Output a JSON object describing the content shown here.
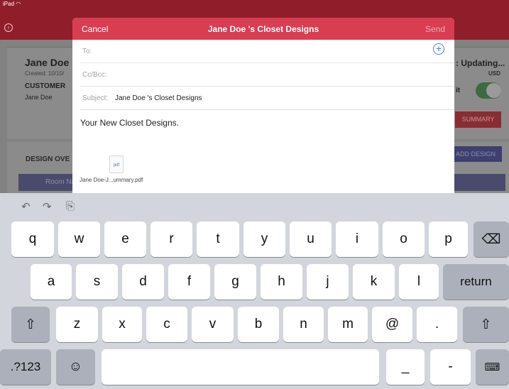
{
  "status_bar": {
    "device": "iPad"
  },
  "app": {
    "customer": {
      "name": "Jane Doe",
      "created": "Created: 10/10/",
      "type_label": "CUSTOMER",
      "contact": "Jane Doe"
    },
    "auto_updating": ": Updating...",
    "currency": "USD",
    "toggle_label": "it",
    "toggle_on": true,
    "summary_button": "SUMMARY",
    "design_overview": "DESIGN OVE",
    "add_design_button": "ADD DESIGN",
    "room_column": "Room Nar"
  },
  "email": {
    "cancel": "Cancel",
    "title": "Jane Doe 's Closet Designs",
    "send": "Send",
    "to_label": "To:",
    "cc_label": "Cc/Bcc:",
    "subject_label": "Subject:",
    "subject_value": "Jane Doe 's Closet Designs",
    "body": "Your New Closet Designs.",
    "attachment": {
      "ext": "pdf",
      "name": "Jane Doe-J...ummary.pdf"
    }
  },
  "keyboard": {
    "shortcuts": [
      "undo-icon",
      "redo-icon",
      "paste-icon"
    ],
    "row1": [
      "q",
      "w",
      "e",
      "r",
      "t",
      "y",
      "u",
      "i",
      "o",
      "p"
    ],
    "row2": [
      "a",
      "s",
      "d",
      "f",
      "g",
      "h",
      "j",
      "k",
      "l"
    ],
    "row3": [
      "z",
      "x",
      "c",
      "v",
      "b",
      "n",
      "m",
      "@",
      "."
    ],
    "return": "return",
    "numbers": ".?123",
    "underscore": "_",
    "dash": "-"
  }
}
